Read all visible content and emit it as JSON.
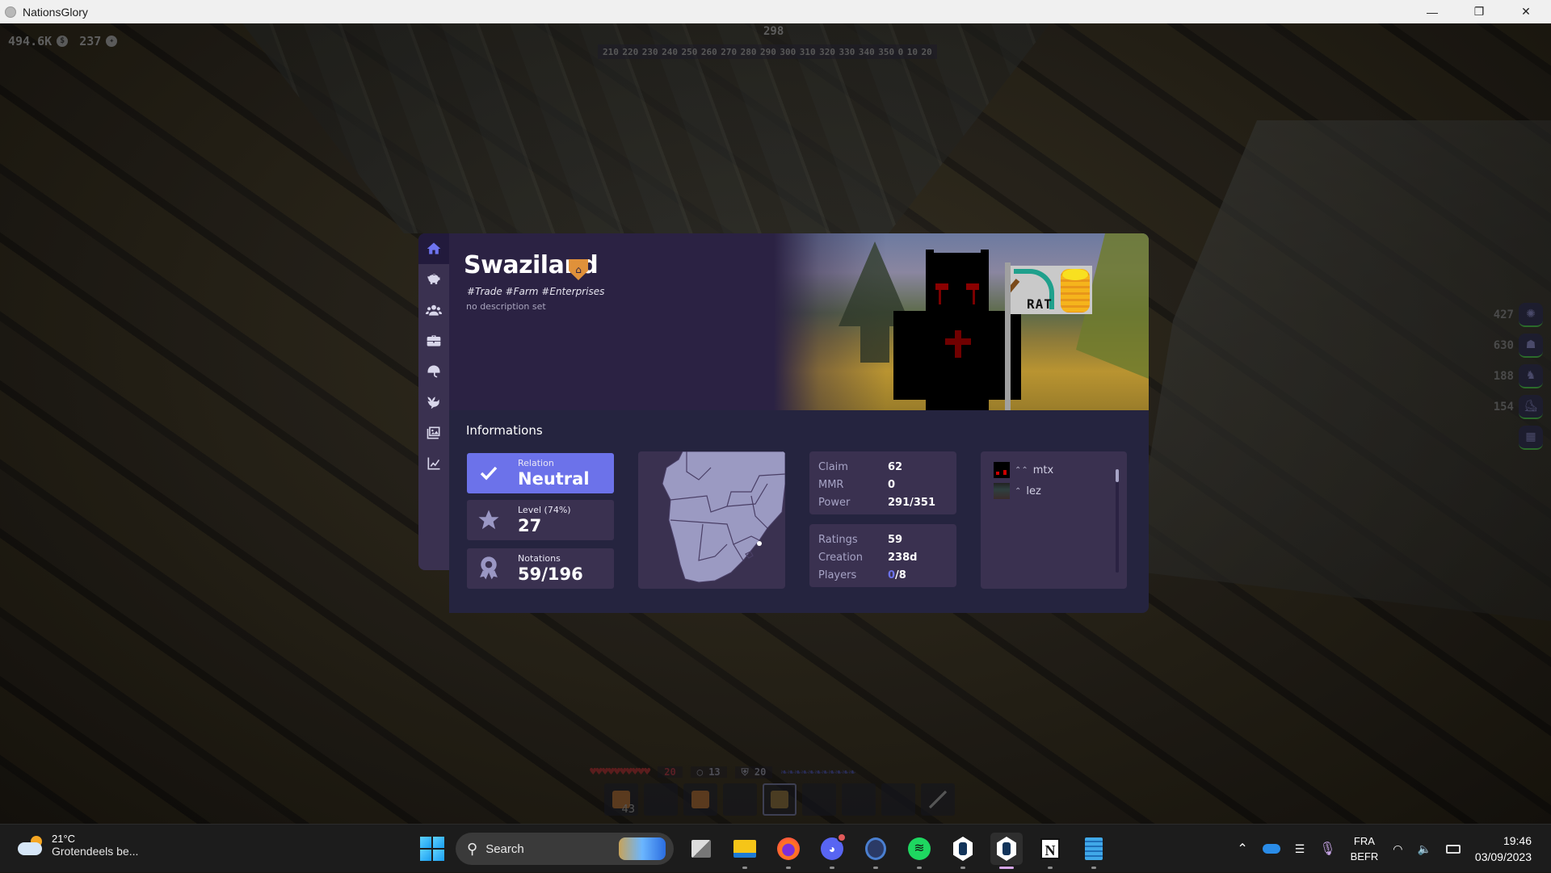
{
  "window": {
    "title": "NationsGlory",
    "controls": {
      "minimize": "—",
      "maximize": "❐",
      "close": "✕"
    }
  },
  "hud": {
    "money": "494.6K",
    "money_icon": "dollar-coin-icon",
    "points": "237",
    "points_icon": "star-coin-icon",
    "compass_heading": "298",
    "compass_ticks": [
      "210",
      "220",
      "230",
      "240",
      "250",
      "260",
      "270",
      "280",
      "290",
      "300",
      "310",
      "320",
      "330",
      "340",
      "350",
      "0",
      "10",
      "20"
    ],
    "right_stats": [
      {
        "value": "427",
        "icon": "magic-icon"
      },
      {
        "value": "630",
        "icon": "mob-icon"
      },
      {
        "value": "188",
        "icon": "horse-icon"
      },
      {
        "value": "154",
        "icon": "boots-icon"
      },
      {
        "value": "",
        "icon": "block-icon"
      }
    ],
    "health_hearts": 10,
    "health": "20",
    "armor": "13",
    "attack": "20",
    "stamina_count": 11,
    "hotbar": [
      {
        "item": "meat",
        "count": "43"
      },
      {
        "item": "",
        "count": ""
      },
      {
        "item": "backpack",
        "count": ""
      },
      {
        "item": "",
        "count": ""
      },
      {
        "item": "oak-log",
        "count": "",
        "selected": true
      },
      {
        "item": "",
        "count": ""
      },
      {
        "item": "",
        "count": ""
      },
      {
        "item": "",
        "count": ""
      },
      {
        "item": "sword",
        "count": ""
      }
    ]
  },
  "panel": {
    "sidebar": [
      {
        "name": "home",
        "icon": "home-icon",
        "active": true
      },
      {
        "name": "economy",
        "icon": "piggy-bank-icon"
      },
      {
        "name": "members",
        "icon": "users-icon"
      },
      {
        "name": "enterprises",
        "icon": "briefcase-icon"
      },
      {
        "name": "military",
        "icon": "helmet-icon"
      },
      {
        "name": "diplomacy",
        "icon": "dove-icon"
      },
      {
        "name": "gallery",
        "icon": "images-icon"
      },
      {
        "name": "stats",
        "icon": "chart-line-icon"
      }
    ],
    "country": {
      "name": "Swaziland",
      "badge_icon": "shield-house-icon",
      "tags": "#Trade #Farm #Enterprises",
      "description": "no description set",
      "flag_text": "RAT"
    },
    "close_label": "✕",
    "info": {
      "title": "Informations",
      "relation": {
        "label": "Relation",
        "value": "Neutral"
      },
      "level": {
        "label": "Level (74%)",
        "value": "27",
        "progress_percent": 74
      },
      "notations": {
        "label": "Notations",
        "value": "59/196"
      },
      "stats1": [
        {
          "key": "Claim",
          "value": "62"
        },
        {
          "key": "MMR",
          "value": "0"
        },
        {
          "key": "Power",
          "value": "291/351"
        }
      ],
      "stats2": [
        {
          "key": "Ratings",
          "value": "59"
        },
        {
          "key": "Creation",
          "value": "238d"
        },
        {
          "key": "Players_label",
          "value": "Players"
        }
      ],
      "players_online": "0",
      "players_total": "/8",
      "members": [
        {
          "name": "mtx",
          "rank": "⌃⌃"
        },
        {
          "name": "lez",
          "rank": "⌃"
        }
      ]
    },
    "colors": {
      "accent": "#6c72ea",
      "badge": "#e0913a",
      "panel_bg": "#25243f",
      "card_bg": "#3a3150"
    }
  },
  "taskbar": {
    "weather": {
      "temp": "21°C",
      "desc": "Grotendeels be..."
    },
    "search_placeholder": "Search",
    "apps": [
      {
        "name": "task-view"
      },
      {
        "name": "file-explorer"
      },
      {
        "name": "firefox"
      },
      {
        "name": "discord",
        "badge": true
      },
      {
        "name": "app-circle"
      },
      {
        "name": "spotify"
      },
      {
        "name": "nationsglory-launcher"
      },
      {
        "name": "nationsglory",
        "active": true
      },
      {
        "name": "notion"
      },
      {
        "name": "notepad"
      }
    ],
    "tray": {
      "lang1": "FRA",
      "lang2": "BEFR",
      "time": "19:46",
      "date": "03/09/2023"
    }
  }
}
